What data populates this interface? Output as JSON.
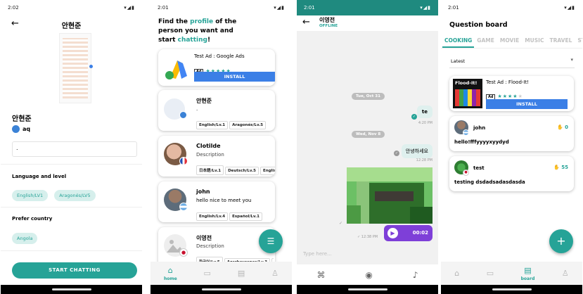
{
  "screen1": {
    "time": "2:02",
    "title": "안현준",
    "name": "안현준",
    "handle": "aq",
    "bio_value": ".",
    "language_section_label": "Language and level",
    "languages": [
      "English/LV1",
      "Aragonés/LV5"
    ],
    "country_section_label": "Prefer country",
    "countries": [
      "Angola"
    ],
    "start_button": "START CHATTING"
  },
  "screen2": {
    "time": "2:01",
    "headline_1": "Find the ",
    "headline_hl1": "profile",
    "headline_2": " of the",
    "headline_3": "person you want and",
    "headline_4": "start ",
    "headline_hl2": "chatting",
    "headline_5": "!",
    "ad": {
      "title": "Test Ad : Google Ads",
      "badge": "Ad",
      "rating": "★★★★★",
      "install": "INSTALL"
    },
    "users": [
      {
        "name": "안현준",
        "desc": ".",
        "tags": [
          "English/Lv.1",
          "Aragonés/Lv.5"
        ]
      },
      {
        "name": "Clotilde",
        "desc": "Description",
        "tags": [
          "日本語/Lv.1",
          "Deutsch/Lv.5",
          "English/"
        ]
      },
      {
        "name": "john",
        "desc": "hello nice to meet you",
        "tags": [
          "English/Lv.4",
          "Español/Lv.1"
        ]
      },
      {
        "name": "이영전",
        "desc": "Description",
        "tags": [
          "한국어/Lv.5",
          "Azarbaycanca/Lv.3",
          "Az"
        ]
      }
    ],
    "nav": {
      "home": "home"
    }
  },
  "screen3": {
    "time": "2:01",
    "contact_name": "이영전",
    "status": "OFFLINE",
    "date1": "Tue, Oct 31",
    "msg1": "te",
    "msg1_time": "4:20 PM",
    "date2": "Wed, Nov 8",
    "msg2": "안녕하세요",
    "msg2_time": "12:28 PM",
    "img_time": "12:38 PM",
    "voice_duration": "00:02",
    "input_placeholder": "Type here..."
  },
  "screen4": {
    "time": "2:01",
    "title": "Question board",
    "tabs": [
      "COOKING",
      "GAME",
      "MOVIE",
      "MUSIC",
      "TRAVEL",
      "ST"
    ],
    "sort": "Latest",
    "ad": {
      "title": "Test Ad : Flood-It!",
      "badge": "Ad",
      "install": "INSTALL",
      "logo_text": "Flood-It!"
    },
    "posts": [
      {
        "user": "john",
        "likes": "0",
        "text": "hello!fffyyyyxyydyd"
      },
      {
        "user": "test",
        "likes": "55",
        "text": "testing dsdadsadasdasda"
      }
    ],
    "nav": {
      "board": "board"
    }
  },
  "colors": {
    "accent": "#26a397",
    "install": "#3b7fe6",
    "voice": "#7e3fd8"
  }
}
